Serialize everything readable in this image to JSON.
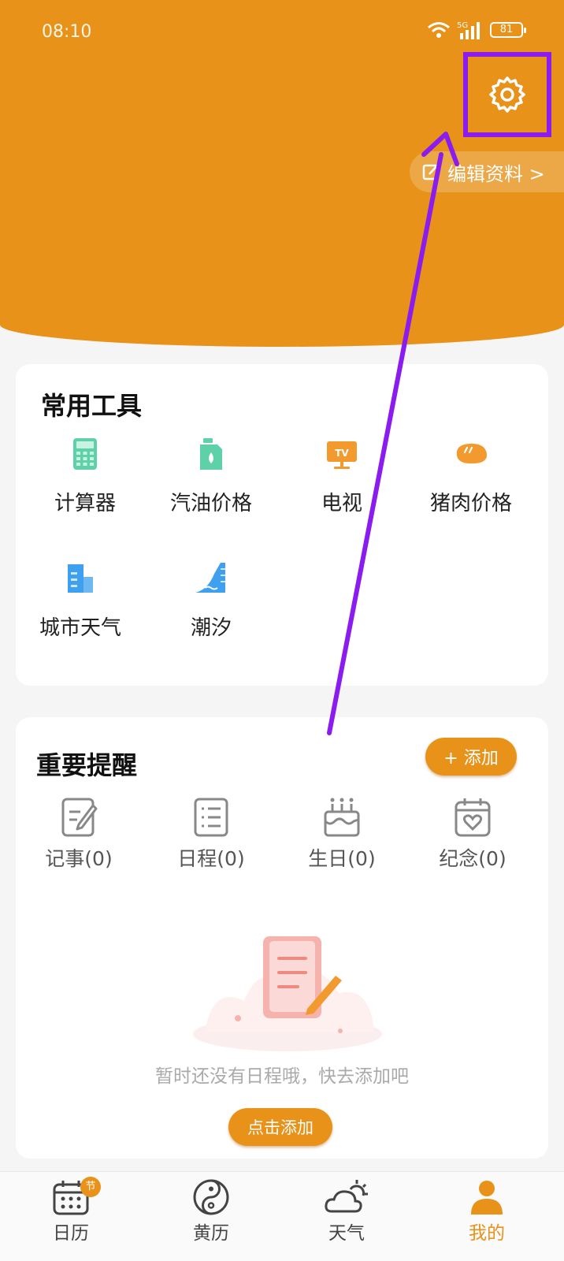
{
  "status": {
    "time": "08:10",
    "network": "5G",
    "battery": "81"
  },
  "header": {
    "edit_profile": "编辑资料 >"
  },
  "tools": {
    "title": "常用工具",
    "items": [
      {
        "label": "计算器",
        "icon": "calculator-icon"
      },
      {
        "label": "汽油价格",
        "icon": "gas-can-icon"
      },
      {
        "label": "电视",
        "icon": "tv-icon"
      },
      {
        "label": "猪肉价格",
        "icon": "meat-icon"
      },
      {
        "label": "城市天气",
        "icon": "city-building-icon"
      },
      {
        "label": "潮汐",
        "icon": "tide-icon"
      }
    ]
  },
  "reminders": {
    "title": "重要提醒",
    "add_label": "+ 添加",
    "items": [
      {
        "label": "记事(0)",
        "icon": "note-icon"
      },
      {
        "label": "日程(0)",
        "icon": "checklist-icon"
      },
      {
        "label": "生日(0)",
        "icon": "birthday-cake-icon"
      },
      {
        "label": "纪念(0)",
        "icon": "heart-calendar-icon"
      }
    ],
    "empty_text": "暂时还没有日程哦，快去添加吧",
    "click_add_label": "点击添加"
  },
  "nav": {
    "items": [
      {
        "label": "日历",
        "badge": "节",
        "icon": "calendar-icon"
      },
      {
        "label": "黄历",
        "icon": "yin-yang-icon"
      },
      {
        "label": "天气",
        "icon": "weather-cloud-icon"
      },
      {
        "label": "我的",
        "icon": "person-icon",
        "active": true
      }
    ]
  },
  "colors": {
    "accent": "#e8921a",
    "annotation": "#8a1cf0"
  }
}
